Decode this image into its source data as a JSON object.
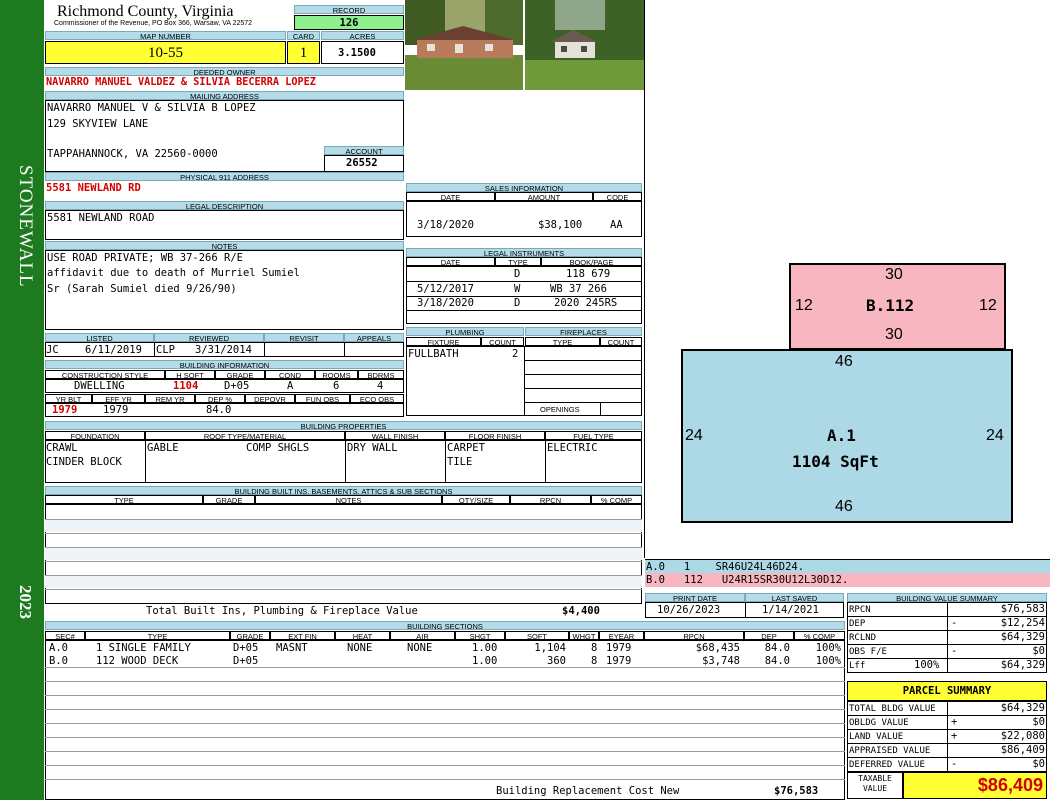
{
  "sidebar": {
    "district": "STONEWALL",
    "year": "2023"
  },
  "header": {
    "county": "Richmond County, Virginia",
    "commissioner": "Commissioner of the Revenue, PO Box 366, Warsaw, VA 22572",
    "record_label": "RECORD",
    "record": "126",
    "map_label": "MAP NUMBER",
    "map": "10-55",
    "card_label": "CARD",
    "card": "1",
    "acres_label": "ACRES",
    "acres": "3.1500"
  },
  "owner": {
    "deeded_label": "DEEDED OWNER",
    "deeded": "NAVARRO MANUEL VALDEZ & SILVIA BECERRA LOPEZ",
    "mailing_label": "MAILING ADDRESS",
    "mailing_line1": "NAVARRO MANUEL V & SILVIA B LOPEZ",
    "mailing_line2": "129 SKYVIEW LANE",
    "mailing_line3": "TAPPAHANNOCK, VA 22560-0000",
    "account_label": "ACCOUNT",
    "account": "26552",
    "physical_label": "PHYSICAL 911 ADDRESS",
    "physical": "5581 NEWLAND RD",
    "legal_label": "LEGAL DESCRIPTION",
    "legal": "5581 NEWLAND ROAD",
    "notes_label": "NOTES",
    "notes_line1": "USE ROAD PRIVATE; WB 37-266 R/E",
    "notes_line2": "affidavit due to death of Murriel Sumiel",
    "notes_line3": "Sr (Sarah Sumiel died 9/26/90)"
  },
  "sales": {
    "title": "SALES INFORMATION",
    "col_date": "DATE",
    "col_amount": "AMOUNT",
    "col_code": "CODE",
    "date": "3/18/2020",
    "amount": "$38,100",
    "code": "AA"
  },
  "instruments": {
    "title": "LEGAL INSTRUMENTS",
    "col_date": "DATE",
    "col_type": "TYPE",
    "col_book": "BOOK/PAGE",
    "rows": [
      {
        "date": "",
        "type": "D",
        "book": "118 679"
      },
      {
        "date": "5/12/2017",
        "type": "W",
        "book": "WB 37 266"
      },
      {
        "date": "3/18/2020",
        "type": "D",
        "book": "2020 245RS"
      }
    ]
  },
  "review": {
    "listed_label": "LISTED",
    "reviewed_label": "REVIEWED",
    "revisit_label": "REVISIT",
    "appeals_label": "APPEALS",
    "listed_by": "JC",
    "listed_date": "6/11/2019",
    "reviewed_by": "CLP",
    "reviewed_date": "3/31/2014"
  },
  "building_info": {
    "title": "BUILDING INFORMATION",
    "col_style": "CONSTRUCTION STYLE",
    "col_hsqft": "H SQFT",
    "col_grade": "GRADE",
    "col_cond": "COND",
    "col_rooms": "ROOMS",
    "col_bdrms": "BDRMS",
    "style": "DWELLING",
    "hsqft": "1104",
    "grade": "D+05",
    "cond": "A",
    "rooms": "6",
    "bdrms": "4",
    "col_yrblt": "YR BLT",
    "col_effyr": "EFF YR",
    "col_remyr": "REM YR",
    "col_dep": "DEP %",
    "col_depovr": "DEPOVR",
    "col_funobs": "FUN OBS",
    "col_ecoobs": "ECO OBS",
    "yrblt": "1979",
    "effyr": "1979",
    "dep": "84.0"
  },
  "plumbing": {
    "title": "PLUMBING",
    "col_fixture": "FIXTURE",
    "col_count": "COUNT",
    "fixture": "FULLBATH",
    "count": "2"
  },
  "fireplaces": {
    "title": "FIREPLACES",
    "col_type": "TYPE",
    "col_count": "COUNT",
    "openings_label": "OPENINGS"
  },
  "properties": {
    "title": "BUILDING PROPERTIES",
    "col_foundation": "FOUNDATION",
    "col_roof": "ROOF TYPE/MATERIAL",
    "col_wall": "WALL FINISH",
    "col_floor": "FLOOR FINISH",
    "col_fuel": "FUEL TYPE",
    "foundation1": "CRAWL",
    "foundation2": "CINDER BLOCK",
    "roof_type": "GABLE",
    "roof_material": "COMP SHGLS",
    "wall": "DRY WALL",
    "floor1": "CARPET",
    "floor2": "TILE",
    "fuel": "ELECTRIC"
  },
  "builtins": {
    "title": "BUILDING BUILT INS, BASEMENTS, ATTICS & SUB SECTIONS",
    "col_type": "TYPE",
    "col_grade": "GRADE",
    "col_notes": "NOTES",
    "col_qty": "QTY/SIZE",
    "col_rpcn": "RPCN",
    "col_comp": "% COMP",
    "total_label": "Total Built Ins, Plumbing & Fireplace Value",
    "total": "$4,400"
  },
  "sections": {
    "title": "BUILDING SECTIONS",
    "cols": [
      "SEC#",
      "TYPE",
      "GRADE",
      "EXT FIN",
      "HEAT",
      "AIR",
      "SHGT",
      "SQFT",
      "WHGT",
      "EYEAR",
      "RPCN",
      "DEP",
      "% COMP"
    ],
    "rows": [
      {
        "sec": "A.0",
        "type": "1 SINGLE FAMILY",
        "grade": "D+05",
        "ext": "MASNT",
        "heat": "NONE",
        "air": "NONE",
        "shgt": "1.00",
        "sqft": "1,104",
        "whgt": "8",
        "eyear": "1979",
        "rpcn": "$68,435",
        "dep": "84.0",
        "comp": "100%"
      },
      {
        "sec": "B.0",
        "type": "112 WOOD DECK",
        "grade": "D+05",
        "ext": "",
        "heat": "",
        "air": "",
        "shgt": "1.00",
        "sqft": "360",
        "whgt": "8",
        "eyear": "1979",
        "rpcn": "$3,748",
        "dep": "84.0",
        "comp": "100%"
      }
    ],
    "replacement_label": "Building Replacement Cost New",
    "replacement": "$76,583"
  },
  "sketch": {
    "deck": {
      "label": "B.112",
      "top": "30",
      "bottom": "30",
      "left": "12",
      "right": "12"
    },
    "house": {
      "label": "A.1",
      "area": "1104 SqFt",
      "top": "46",
      "bottom": "46",
      "left": "24",
      "right": "24"
    },
    "vector_a": "A.0   1    SR46U24L46D24.",
    "vector_b": "B.0   112   U24R15SR30U12L30D12.",
    "colors": {
      "deck": "#f7b6c0",
      "house": "#add8e6"
    }
  },
  "dates": {
    "print_label": "PRINT DATE",
    "print": "10/26/2023",
    "saved_label": "LAST SAVED",
    "saved": "1/14/2021"
  },
  "value_summary": {
    "title": "BUILDING VALUE SUMMARY",
    "rows": [
      {
        "label": "RPCN",
        "pct": "",
        "sign": "",
        "value": "$76,583"
      },
      {
        "label": "DEP",
        "pct": "",
        "sign": "-",
        "value": "$12,254"
      },
      {
        "label": "RCLND",
        "pct": "",
        "sign": "",
        "value": "$64,329"
      },
      {
        "label": "OBS F/E",
        "pct": "",
        "sign": "-",
        "value": "$0"
      },
      {
        "label": "Lff",
        "pct": "100%",
        "sign": "",
        "value": "$64,329"
      }
    ]
  },
  "parcel": {
    "title": "PARCEL SUMMARY",
    "rows": [
      {
        "label": "TOTAL BLDG VALUE",
        "sign": "",
        "value": "$64,329"
      },
      {
        "label": "OBLDG VALUE",
        "sign": "+",
        "value": "$0"
      },
      {
        "label": "LAND VALUE",
        "sign": "+",
        "value": "$22,080"
      },
      {
        "label": "APPRAISED VALUE",
        "sign": "",
        "value": "$86,409"
      },
      {
        "label": "DEFERRED VALUE",
        "sign": "-",
        "value": "$0"
      }
    ],
    "taxable_label": "TAXABLE VALUE",
    "taxable": "$86,409"
  }
}
